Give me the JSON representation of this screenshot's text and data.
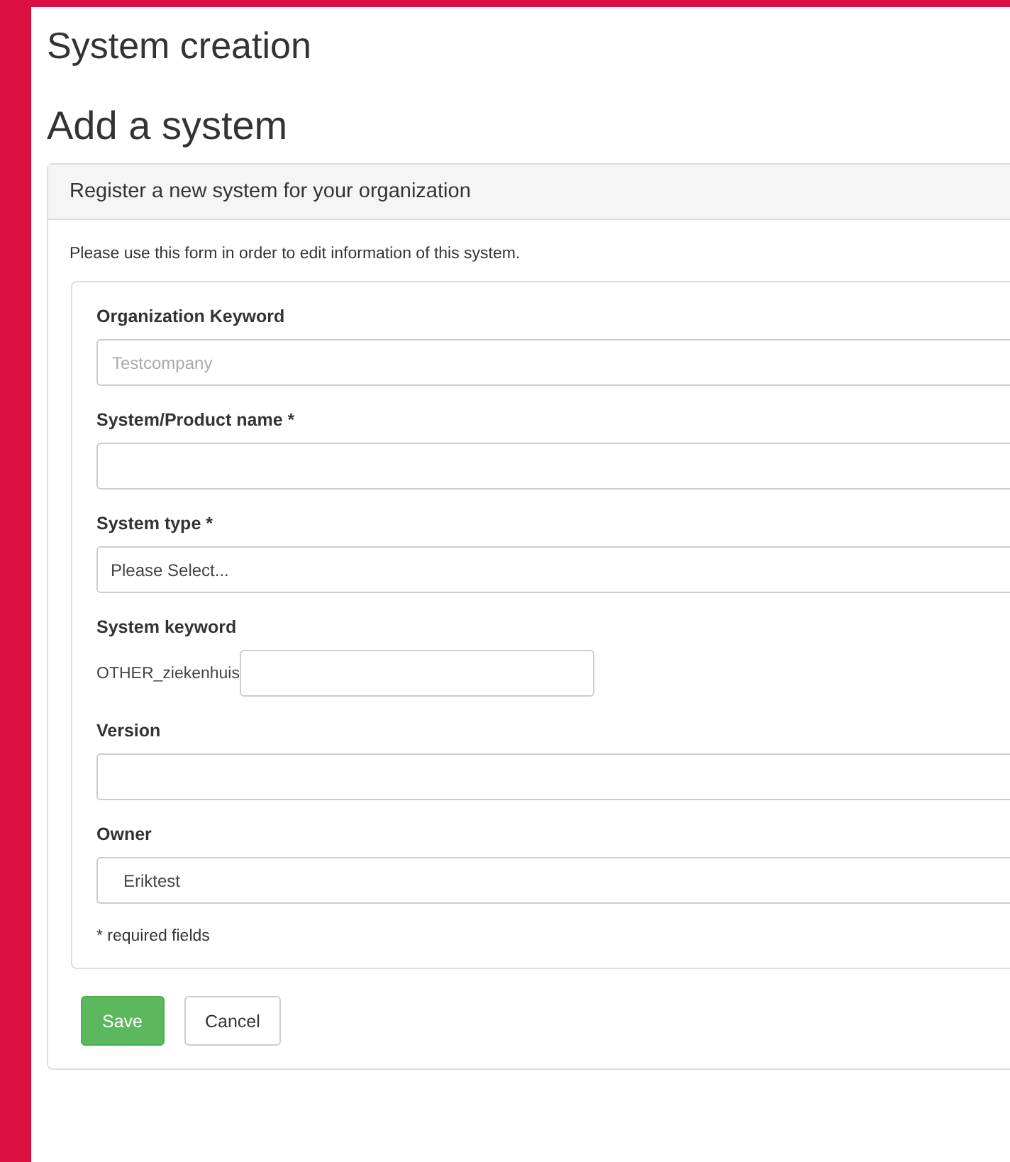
{
  "page_title": "System creation",
  "form_title": "Add a system",
  "panel": {
    "header": "Register a new system for your organization",
    "description": "Please use this form in order to edit information of this system."
  },
  "fields": [
    {
      "kind": "text",
      "label": "Organization Keyword",
      "placeholder": "Testcompany"
    },
    {
      "kind": "text",
      "label": "System/Product name *"
    },
    {
      "kind": "select",
      "label": "System type *",
      "value": "Please Select..."
    },
    {
      "kind": "prefixed",
      "label": "System keyword",
      "prefix": "OTHER_ziekenhuis"
    },
    {
      "kind": "text",
      "label": "Version"
    },
    {
      "kind": "select",
      "label": "Owner",
      "value": "Eriktest"
    }
  ],
  "required_note": "* required fields",
  "buttons": [
    {
      "kind": "primary",
      "label": "Save"
    },
    {
      "kind": "default",
      "label": "Cancel"
    }
  ]
}
